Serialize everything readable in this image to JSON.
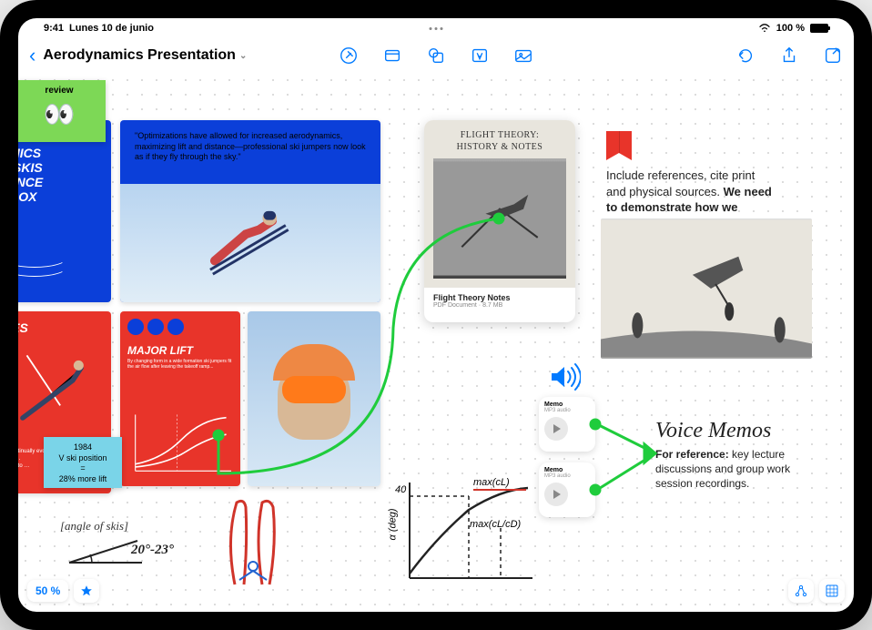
{
  "status": {
    "time": "9:41",
    "date": "Lunes 10 de junio",
    "battery": "100 %"
  },
  "header": {
    "title": "Aerodynamics Presentation"
  },
  "stickies": {
    "review": "review",
    "vski": {
      "line1": "1984",
      "line2": "V ski position",
      "line3": "=",
      "line4": "28% more lift"
    }
  },
  "posters": {
    "p1": "NS\nAMICS\nN SKIS\nTANCE\nADOX\nNS",
    "p2_quote": "\"Optimizations have allowed for increased aerodynamics, maximizing lift and distance—professional ski jumpers now look as if they fly through the sky.\"",
    "p3_title": "UES",
    "p3_body": "as continually evolved\nay of …\nations to …\nther\nrie.",
    "p4_title": "MAJOR LIFT"
  },
  "pdf": {
    "cover_title": "FLIGHT THEORY:\nHISTORY & NOTES",
    "meta_title": "Flight Theory Notes",
    "meta_sub": "PDF Document · 8.7 MB"
  },
  "ref": {
    "body1": "Include references, cite print and physical sources.",
    "body2": "We need to demonstrate how we researched theory and concepts."
  },
  "memos": {
    "title": "Memo",
    "sub": "MP3 audio"
  },
  "voice": {
    "title": "Voice Memos",
    "label": "For reference:",
    "body": " key lecture discussions and group work session recordings."
  },
  "angle": {
    "label": "[angle of skis]",
    "value": "20°-23°"
  },
  "graph": {
    "ylabel": "α (deg)",
    "tick": "40",
    "ann1": "max(cL)",
    "ann2": "max(cL/cD)"
  },
  "zoom": "50 %"
}
